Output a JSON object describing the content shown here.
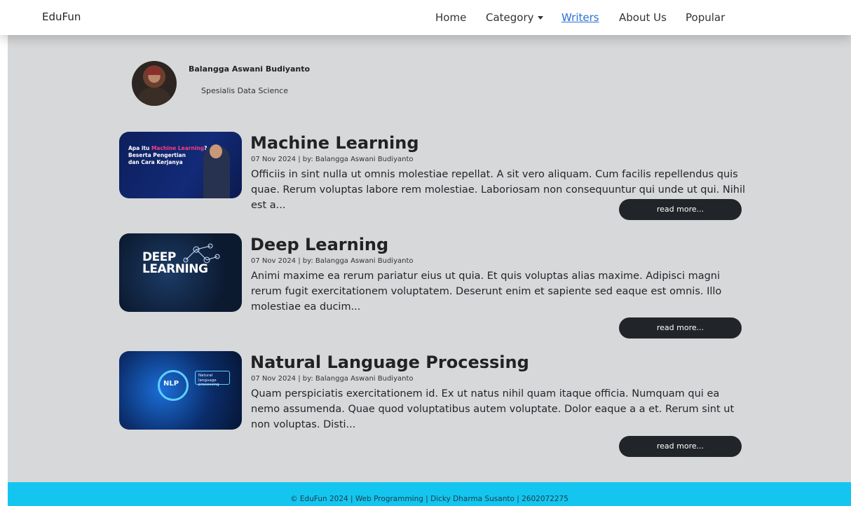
{
  "navbar": {
    "brand": "EduFun",
    "links": [
      {
        "label": "Home"
      },
      {
        "label": "Category"
      },
      {
        "label": "Writers"
      },
      {
        "label": "About Us"
      },
      {
        "label": "Popular"
      }
    ]
  },
  "author": {
    "name": "Balangga Aswani Budiyanto",
    "role": "Spesialis Data Science"
  },
  "articles": [
    {
      "title": "Machine Learning",
      "meta": "07 Nov 2024 | by: Balangga Aswani Budiyanto",
      "excerpt": "Officiis in sint nulla ut omnis molestiae repellat. A sit vero aliquam. Cum facilis repellendus quis quae. Rerum voluptas labore rem molestiae. Laboriosam non consequuntur qui unde ut qui. Nihil est a...",
      "button": "read more...",
      "thumb": {
        "line1": "Apa itu ",
        "highlight": "Machine Learning",
        "line2": "?",
        "line3": "Beserta Pengertian",
        "line4": "dan Cara Kerjanya"
      }
    },
    {
      "title": "Deep Learning",
      "meta": "07 Nov 2024 | by: Balangga Aswani Budiyanto",
      "excerpt": "Animi maxime ea rerum pariatur eius ut quia. Et quis voluptas alias maxime. Adipisci magni rerum fugit exercitationem voluptatem. Deserunt enim et sapiente sed eaque est omnis. Illo molestiae ea ducim...",
      "button": "read more...",
      "thumb": {
        "word1": "DEEP",
        "word2": "LEARNING"
      }
    },
    {
      "title": "Natural Language Processing",
      "meta": "07 Nov 2024 | by: Balangga Aswani Budiyanto",
      "excerpt": "Quam perspiciatis exercitationem id. Ex ut natus nihil quam itaque officia. Numquam qui ea nemo assumenda. Quae quod voluptatibus autem voluptate. Dolor eaque a a et. Rerum sint ut non voluptas. Disti...",
      "button": "read more...",
      "thumb": {
        "badge": "NLP",
        "box": "Natural language processing"
      }
    }
  ],
  "footer": {
    "text": "© EduFun 2024 | Web Programming | Dicky Dharma Susanto | 2602072275"
  },
  "colors": {
    "accent_link": "#2a6fd6",
    "main_bg": "#d7d8da",
    "footer_bg": "#14c6ef",
    "button_bg": "#212529"
  }
}
